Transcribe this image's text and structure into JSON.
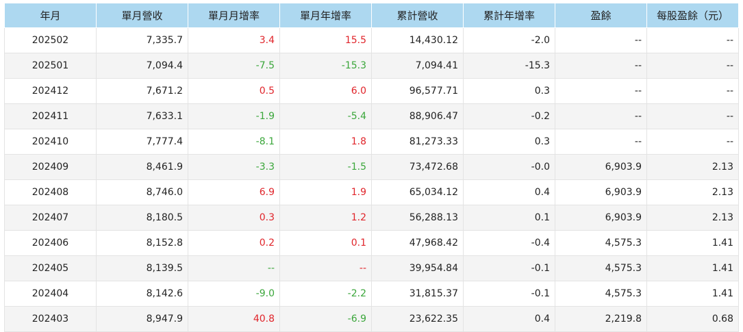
{
  "colors": {
    "header_bg": "#add8f0",
    "positive": "#e0242a",
    "negative": "#3aa63a",
    "row_alt": "#f4f4f4"
  },
  "table": {
    "columns": [
      "年月",
      "單月營收",
      "單月月增率",
      "單月年增率",
      "累計營收",
      "累計年增率",
      "盈餘",
      "每股盈餘（元）"
    ],
    "rows": [
      {
        "month": "202502",
        "revenue": "7,335.7",
        "mom": "3.4",
        "mom_tone": "up",
        "yoy": "15.5",
        "yoy_tone": "up",
        "cum_revenue": "14,430.12",
        "cum_yoy": "-2.0",
        "earnings": "--",
        "eps": "--"
      },
      {
        "month": "202501",
        "revenue": "7,094.4",
        "mom": "-7.5",
        "mom_tone": "down",
        "yoy": "-15.3",
        "yoy_tone": "down",
        "cum_revenue": "7,094.41",
        "cum_yoy": "-15.3",
        "earnings": "--",
        "eps": "--"
      },
      {
        "month": "202412",
        "revenue": "7,671.2",
        "mom": "0.5",
        "mom_tone": "up",
        "yoy": "6.0",
        "yoy_tone": "up",
        "cum_revenue": "96,577.71",
        "cum_yoy": "0.3",
        "earnings": "--",
        "eps": "--"
      },
      {
        "month": "202411",
        "revenue": "7,633.1",
        "mom": "-1.9",
        "mom_tone": "down",
        "yoy": "-5.4",
        "yoy_tone": "down",
        "cum_revenue": "88,906.47",
        "cum_yoy": "-0.2",
        "earnings": "--",
        "eps": "--"
      },
      {
        "month": "202410",
        "revenue": "7,777.4",
        "mom": "-8.1",
        "mom_tone": "down",
        "yoy": "1.8",
        "yoy_tone": "up",
        "cum_revenue": "81,273.33",
        "cum_yoy": "0.3",
        "earnings": "--",
        "eps": "--"
      },
      {
        "month": "202409",
        "revenue": "8,461.9",
        "mom": "-3.3",
        "mom_tone": "down",
        "yoy": "-1.5",
        "yoy_tone": "down",
        "cum_revenue": "73,472.68",
        "cum_yoy": "-0.0",
        "earnings": "6,903.9",
        "eps": "2.13"
      },
      {
        "month": "202408",
        "revenue": "8,746.0",
        "mom": "6.9",
        "mom_tone": "up",
        "yoy": "1.9",
        "yoy_tone": "up",
        "cum_revenue": "65,034.12",
        "cum_yoy": "0.4",
        "earnings": "6,903.9",
        "eps": "2.13"
      },
      {
        "month": "202407",
        "revenue": "8,180.5",
        "mom": "0.3",
        "mom_tone": "up",
        "yoy": "1.2",
        "yoy_tone": "up",
        "cum_revenue": "56,288.13",
        "cum_yoy": "0.1",
        "earnings": "6,903.9",
        "eps": "2.13"
      },
      {
        "month": "202406",
        "revenue": "8,152.8",
        "mom": "0.2",
        "mom_tone": "up",
        "yoy": "0.1",
        "yoy_tone": "up",
        "cum_revenue": "47,968.42",
        "cum_yoy": "-0.4",
        "earnings": "4,575.3",
        "eps": "1.41"
      },
      {
        "month": "202405",
        "revenue": "8,139.5",
        "mom": "--",
        "mom_tone": "down",
        "yoy": "--",
        "yoy_tone": "up",
        "cum_revenue": "39,954.84",
        "cum_yoy": "-0.1",
        "earnings": "4,575.3",
        "eps": "1.41"
      },
      {
        "month": "202404",
        "revenue": "8,142.6",
        "mom": "-9.0",
        "mom_tone": "down",
        "yoy": "-2.2",
        "yoy_tone": "down",
        "cum_revenue": "31,815.37",
        "cum_yoy": "-0.1",
        "earnings": "4,575.3",
        "eps": "1.41"
      },
      {
        "month": "202403",
        "revenue": "8,947.9",
        "mom": "40.8",
        "mom_tone": "up",
        "yoy": "-6.9",
        "yoy_tone": "down",
        "cum_revenue": "23,622.35",
        "cum_yoy": "0.4",
        "earnings": "2,219.8",
        "eps": "0.68"
      }
    ]
  }
}
